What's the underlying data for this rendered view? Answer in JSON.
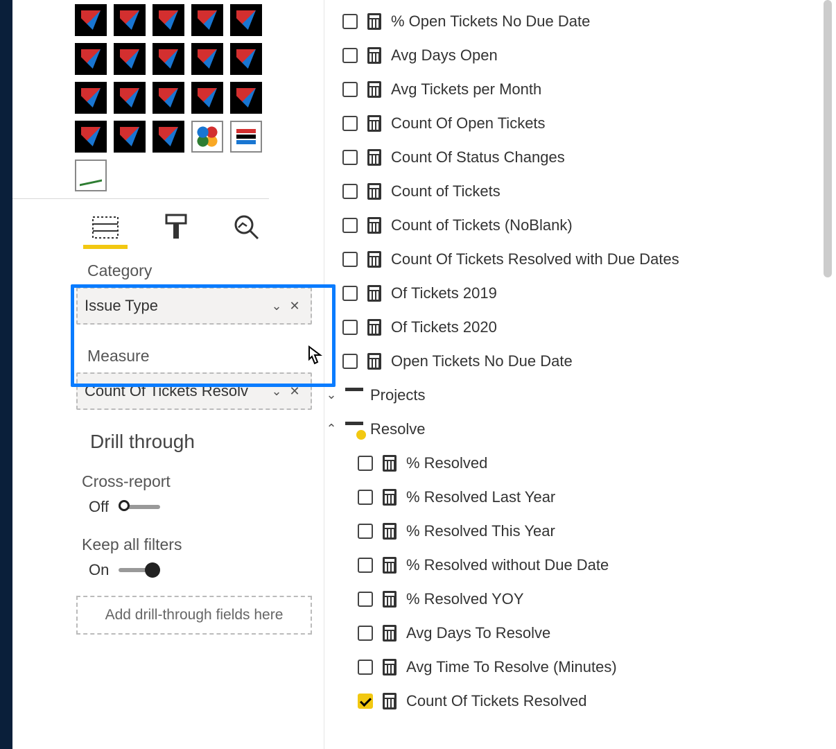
{
  "viz": {
    "section_category": "Category",
    "category_value": "Issue Type",
    "section_measure": "Measure",
    "measure_value": "Count Of Tickets Resolv",
    "drill_heading": "Drill through",
    "cross_label": "Cross-report",
    "cross_value": "Off",
    "keep_label": "Keep all filters",
    "keep_value": "On",
    "drop_placeholder": "Add drill-through fields here"
  },
  "fields": {
    "items": [
      {
        "label": "% Open Tickets No Due Date",
        "checked": false
      },
      {
        "label": "Avg Days Open",
        "checked": false
      },
      {
        "label": "Avg Tickets per Month",
        "checked": false
      },
      {
        "label": "Count Of Open Tickets",
        "checked": false
      },
      {
        "label": "Count Of Status Changes",
        "checked": false
      },
      {
        "label": "Count of Tickets",
        "checked": false
      },
      {
        "label": "Count of Tickets (NoBlank)",
        "checked": false
      },
      {
        "label": "Count Of Tickets Resolved with Due Dates",
        "checked": false
      },
      {
        "label": "Of Tickets 2019",
        "checked": false
      },
      {
        "label": "Of Tickets 2020",
        "checked": false
      },
      {
        "label": "Open Tickets No Due Date",
        "checked": false
      }
    ],
    "group_projects": "Projects",
    "group_resolve": "Resolve",
    "resolve_items": [
      {
        "label": "% Resolved",
        "checked": false
      },
      {
        "label": "% Resolved Last Year",
        "checked": false
      },
      {
        "label": "% Resolved This Year",
        "checked": false
      },
      {
        "label": "% Resolved without Due Date",
        "checked": false
      },
      {
        "label": "% Resolved YOY",
        "checked": false
      },
      {
        "label": "Avg Days To Resolve",
        "checked": false
      },
      {
        "label": "Avg Time To Resolve (Minutes)",
        "checked": false
      },
      {
        "label": "Count Of Tickets Resolved",
        "checked": true
      }
    ]
  }
}
